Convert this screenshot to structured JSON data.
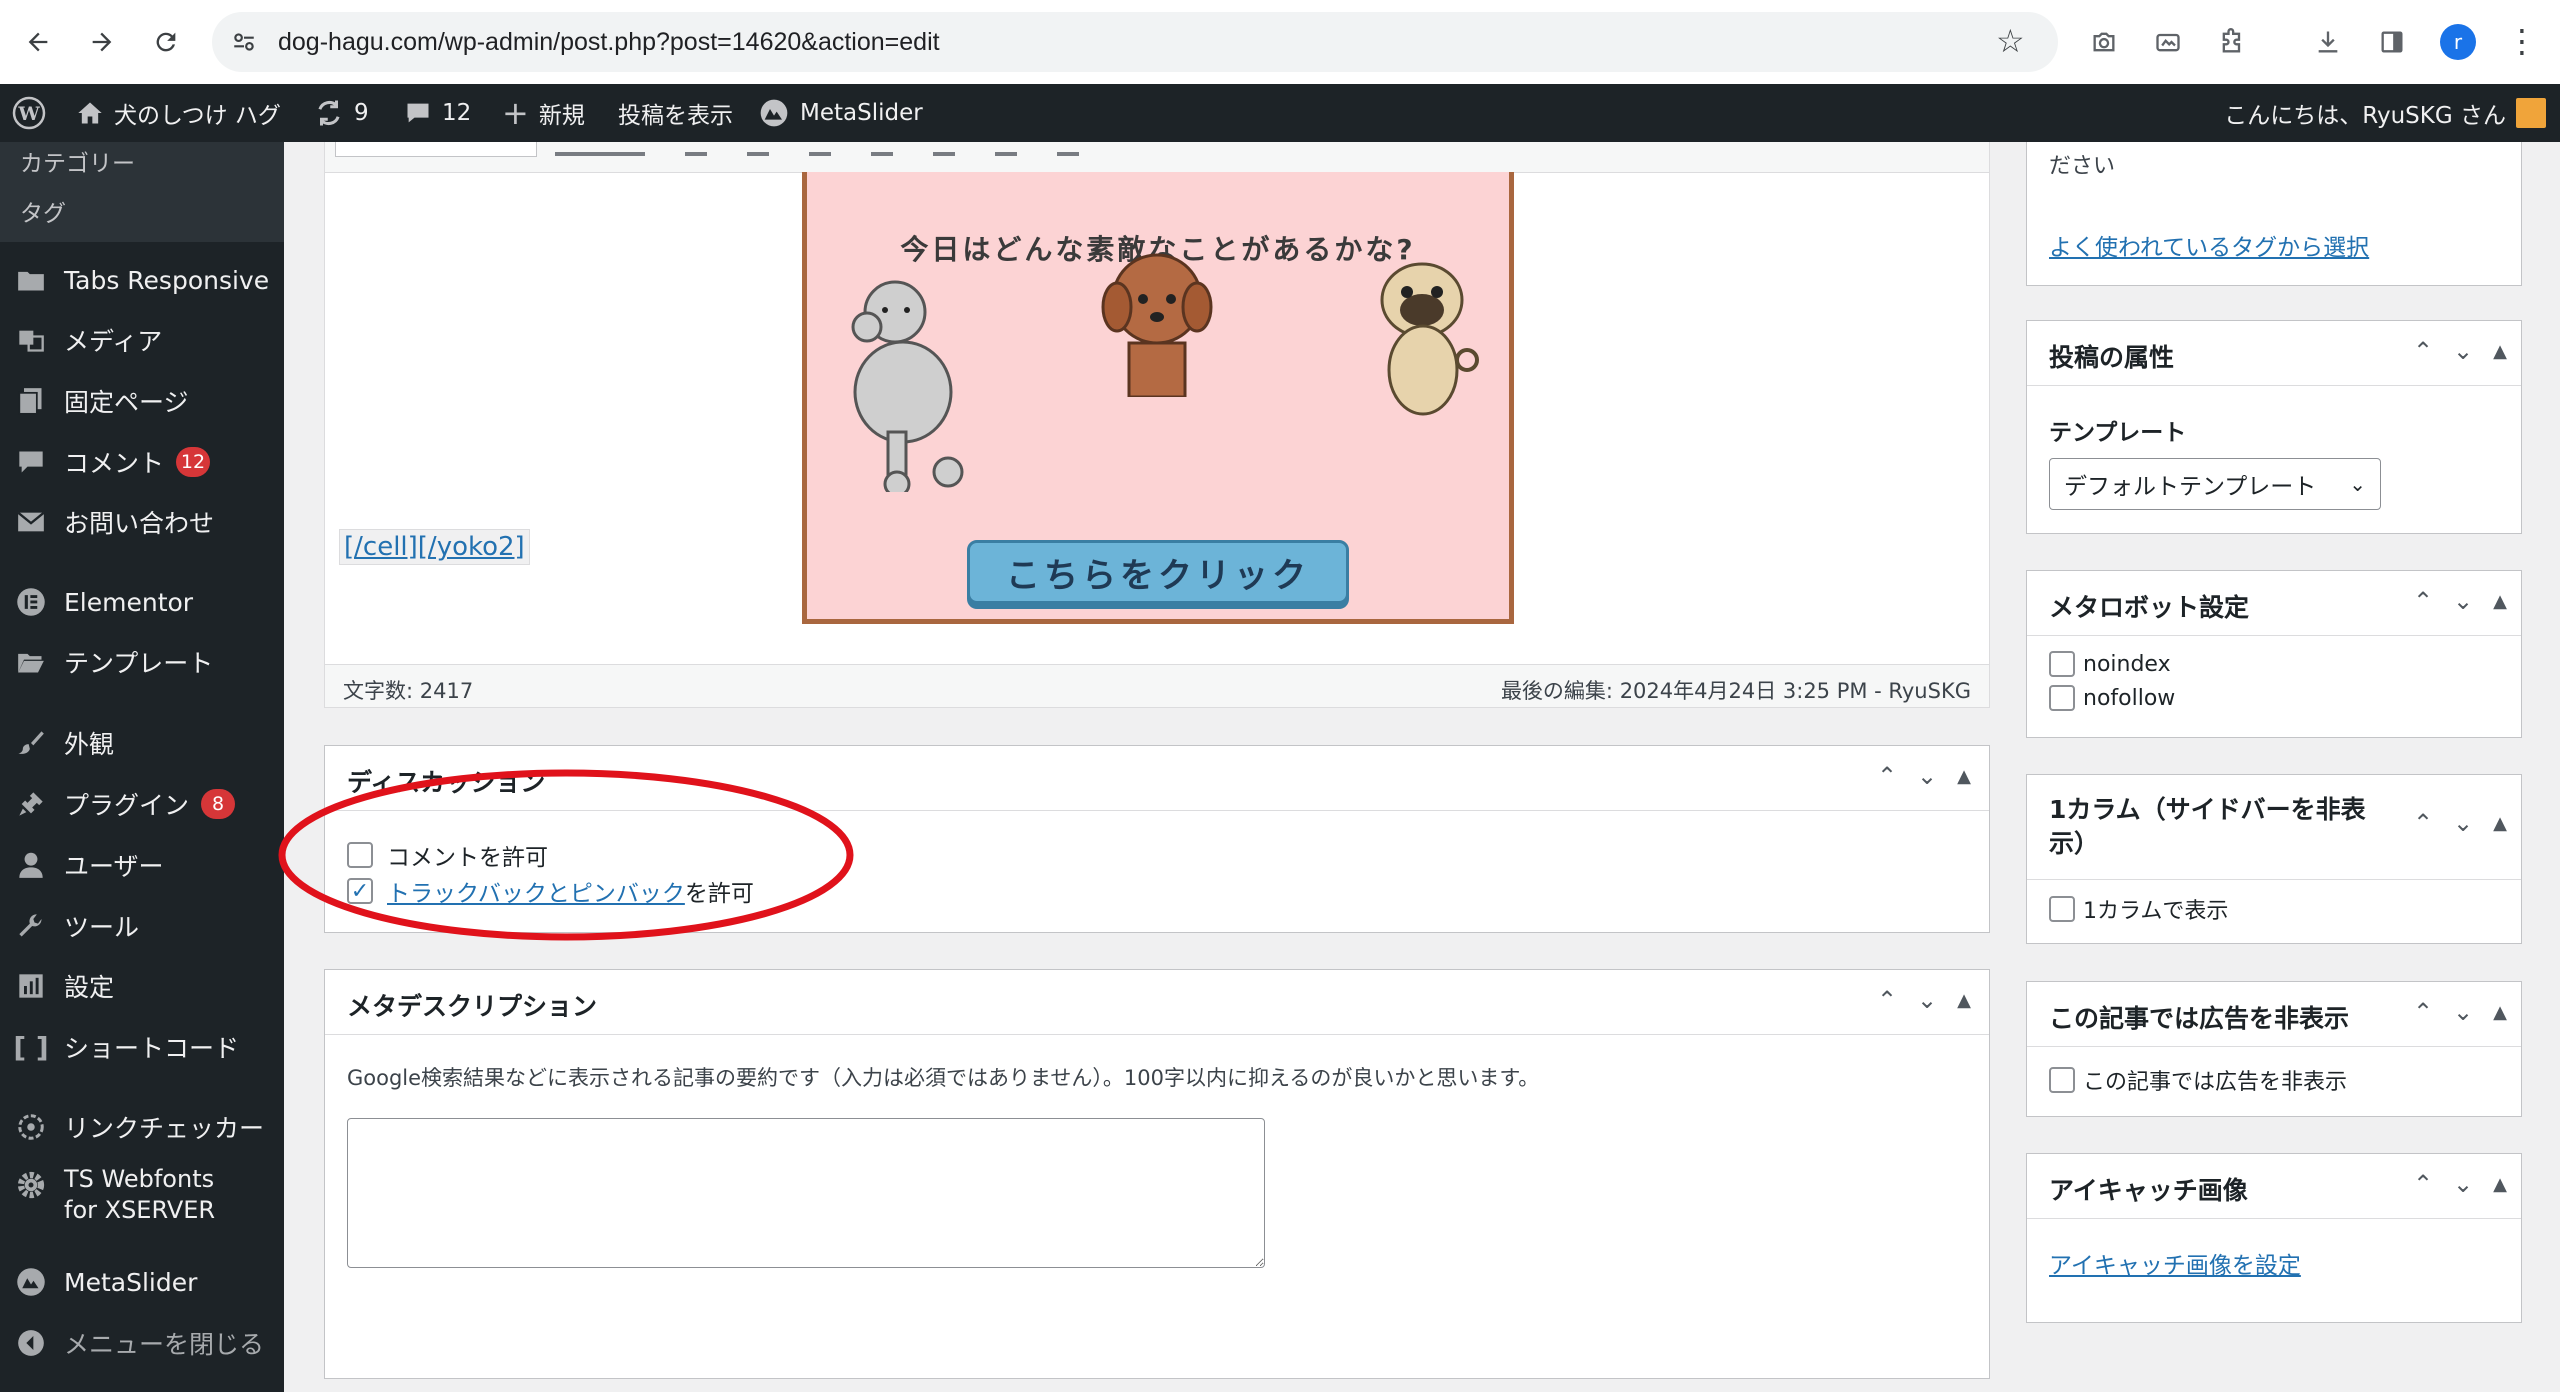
{
  "browser": {
    "url": "dog-hagu.com/wp-admin/post.php?post=14620&action=edit",
    "profile_initial": "r"
  },
  "adminbar": {
    "site_name": "犬のしつけ ハグ",
    "updates_count": "9",
    "comments_count": "12",
    "new_label": "新規",
    "view_post_label": "投稿を表示",
    "metaslider_label": "MetaSlider",
    "greeting": "こんにちは、RyuSKG さん"
  },
  "sidebar": {
    "submenu": [
      "カテゴリー",
      "タグ"
    ],
    "items": [
      {
        "label": "Tabs Responsive",
        "icon": "folder-icon"
      },
      {
        "label": "メディア",
        "icon": "media-icon"
      },
      {
        "label": "固定ページ",
        "icon": "page-icon"
      },
      {
        "label": "コメント",
        "icon": "comment-icon",
        "badge": "12"
      },
      {
        "label": "お問い合わせ",
        "icon": "mail-icon"
      },
      {
        "label": "Elementor",
        "icon": "elementor-icon"
      },
      {
        "label": "テンプレート",
        "icon": "folder-open-icon"
      },
      {
        "label": "外観",
        "icon": "brush-icon"
      },
      {
        "label": "プラグイン",
        "icon": "plugin-icon",
        "badge": "8"
      },
      {
        "label": "ユーザー",
        "icon": "user-icon"
      },
      {
        "label": "ツール",
        "icon": "wrench-icon"
      },
      {
        "label": "設定",
        "icon": "settings-icon"
      },
      {
        "label": "ショートコード",
        "icon": "brackets-icon"
      },
      {
        "label": "リンクチェッカー",
        "icon": "link-checker-icon"
      },
      {
        "label": "TS Webfonts for XSERVER",
        "icon": "gear-icon"
      },
      {
        "label": "MetaSlider",
        "icon": "metaslider-icon"
      },
      {
        "label": "メニューを閉じる",
        "icon": "collapse-icon"
      }
    ]
  },
  "editor": {
    "banner_text": "今日はどんな素敵なことがあるかな?",
    "banner_button": "こちらをクリック",
    "shortcode_text": "[/cell][/yoko2]",
    "word_count": "文字数: 2417",
    "last_edit": "最後の編集: 2024年4月24日 3:25 PM - RyuSKG"
  },
  "discussion": {
    "title": "ディスカッション",
    "allow_comments": "コメントを許可",
    "trackback_link": "トラックバックとピンバック",
    "trackback_suffix": "を許可",
    "allow_comments_checked": false,
    "trackback_checked": true
  },
  "meta_description": {
    "title": "メタデスクリプション",
    "help": "Google検索結果などに表示される記事の要約です（入力は必須ではありません）。100字以内に抑えるのが良いかと思います。",
    "value": ""
  },
  "right_sidebar": {
    "tags_partial_text": "ださい",
    "tags_link": "よく使われているタグから選択",
    "attributes": {
      "title": "投稿の属性",
      "template_label": "テンプレート",
      "template_value": "デフォルトテンプレート"
    },
    "robots": {
      "title": "メタロボット設定",
      "noindex": "noindex",
      "nofollow": "nofollow"
    },
    "one_column": {
      "title": "1カラム（サイドバーを非表示）",
      "option": "1カラムで表示"
    },
    "hide_ads": {
      "title": "この記事では広告を非表示",
      "option": "この記事では広告を非表示"
    },
    "featured_image": {
      "title": "アイキャッチ画像",
      "link": "アイキャッチ画像を設定"
    }
  },
  "colors": {
    "admin_bar": "#1d2327",
    "link": "#2271b1",
    "badge": "#d63638",
    "annotation": "#e0121b",
    "banner_bg": "#fcd3d4",
    "banner_border": "#a9673f"
  }
}
